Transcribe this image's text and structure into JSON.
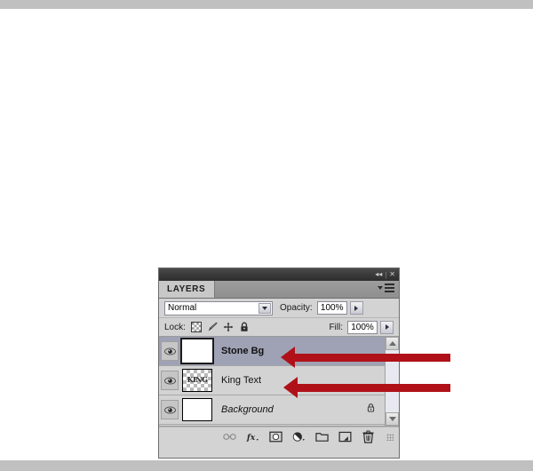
{
  "page": {
    "background_color": "#ffffff",
    "chrome_bar_color": "#c0c0c0"
  },
  "panel": {
    "name": "Photoshop Layers Panel",
    "titlebar": {
      "collapse_icon": "collapse-to-icons-icon",
      "collapse_glyph": "◂◂",
      "separator": "|",
      "close_glyph": "✕"
    },
    "tab": {
      "label": "LAYERS",
      "menu_icon": "panel-menu-icon"
    },
    "blend_row": {
      "blend_mode": "Normal",
      "opacity_label": "Opacity:",
      "opacity_value": "100%"
    },
    "lock_row": {
      "lock_label": "Lock:",
      "lock_icons": [
        "lock-transparent-pixels-icon",
        "lock-image-pixels-icon",
        "lock-position-icon",
        "lock-all-icon"
      ],
      "fill_label": "Fill:",
      "fill_value": "100%"
    },
    "layers": [
      {
        "name": "Stone Bg",
        "visible": true,
        "selected": true,
        "style": "bold",
        "thumbnail": "solid-white-thumbnail",
        "locked": false
      },
      {
        "name": "King Text",
        "visible": true,
        "selected": false,
        "style": "normal",
        "thumbnail": "transparent-checker-thumbnail",
        "thumbnail_text": "KING",
        "locked": false
      },
      {
        "name": "Background",
        "visible": true,
        "selected": false,
        "style": "italic",
        "thumbnail": "solid-white-thumbnail",
        "locked": true,
        "lock_icon": "padlock-icon"
      }
    ],
    "scrollbar": {
      "up_arrow": "scroll-up-arrow-icon",
      "down_arrow": "scroll-down-arrow-icon"
    },
    "footer_buttons": [
      {
        "icon": "link-layers-icon",
        "label": "Link layers"
      },
      {
        "icon": "layer-style-fx-icon",
        "label": "Add a layer style"
      },
      {
        "icon": "layer-mask-icon",
        "label": "Add layer mask"
      },
      {
        "icon": "adjustment-layer-icon",
        "label": "Create new fill or adjustment layer"
      },
      {
        "icon": "new-group-icon",
        "label": "Create a new group"
      },
      {
        "icon": "new-layer-icon",
        "label": "Create a new layer"
      },
      {
        "icon": "delete-layer-icon",
        "label": "Delete layer"
      }
    ],
    "resize_grip": "resize-grip-icon"
  },
  "annotations": {
    "color": "#b01118",
    "arrows": [
      {
        "name": "arrow-pointing-to-stone-bg-layer",
        "direction": "left"
      },
      {
        "name": "arrow-pointing-to-king-text-layer",
        "direction": "left"
      }
    ]
  }
}
